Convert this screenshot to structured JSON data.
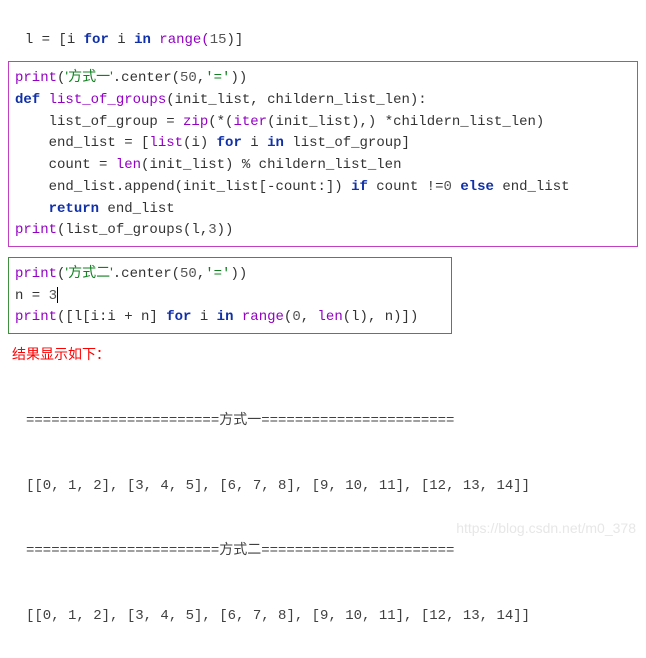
{
  "top_line": {
    "var": "l",
    "expr_prefix": " = [i ",
    "for": "for",
    "mid": " i ",
    "in": "in",
    "call": " range(",
    "n": "15",
    "suffix": ")]"
  },
  "block1": {
    "l1": {
      "fn": "print",
      "open": "(",
      "s": "'方式一'",
      "mid": ".center(",
      "a": "50",
      "c": ",",
      "b": "'='",
      "close": "))"
    },
    "l2": {
      "def": "def",
      "name": " list_of_groups",
      "args": "(init_list, childern_list_len):"
    },
    "l3": {
      "indent": "    ",
      "var": "list_of_group = ",
      "fn": "zip",
      "args": "(*(",
      "it": "iter",
      "tail": "(init_list),) *childern_list_len)"
    },
    "l4": {
      "indent": "    ",
      "var": "end_list = [",
      "fn": "list",
      "open": "(i) ",
      "for": "for",
      "mid": " i ",
      "in": "in",
      "tail": " list_of_group]"
    },
    "l5": {
      "indent": "    ",
      "var": "count = ",
      "fn": "len",
      "tail": "(init_list) % childern_list_len"
    },
    "l6": {
      "indent": "    ",
      "pre": "end_list.append(init_list[-count:]) ",
      "if": "if",
      "mid": " count !=",
      "z": "0",
      "sp": " ",
      "else": "else",
      "tail": " end_list"
    },
    "l7": {
      "indent": "    ",
      "ret": "return",
      "tail": " end_list"
    },
    "l8": {
      "fn": "print",
      "args": "(list_of_groups(l,",
      "n": "3",
      "close": "))"
    }
  },
  "block2": {
    "l1": {
      "fn": "print",
      "open": "(",
      "s": "'方式二'",
      "mid": ".center(",
      "a": "50",
      "c": ",",
      "b": "'='",
      "close": "))"
    },
    "l2": {
      "var": "n = ",
      "n": "3"
    },
    "l3": {
      "fn": "print",
      "open": "([l[i:i + n] ",
      "for": "for",
      "mid": " i ",
      "in": "in",
      "sp": " ",
      "rng": "range",
      "args": "(",
      "z": "0",
      "c1": ", ",
      "len": "len",
      "tail": "(l), n)])"
    }
  },
  "result_label": "结果显示如下：",
  "output": {
    "l1": "=======================方式一=======================",
    "l2": "[[0, 1, 2], [3, 4, 5], [6, 7, 8], [9, 10, 11], [12, 13, 14]]",
    "l3": "=======================方式二=======================",
    "l4": "[[0, 1, 2], [3, 4, 5], [6, 7, 8], [9, 10, 11], [12, 13, 14]]"
  },
  "watermark": "https://blog.csdn.net/m0_378"
}
